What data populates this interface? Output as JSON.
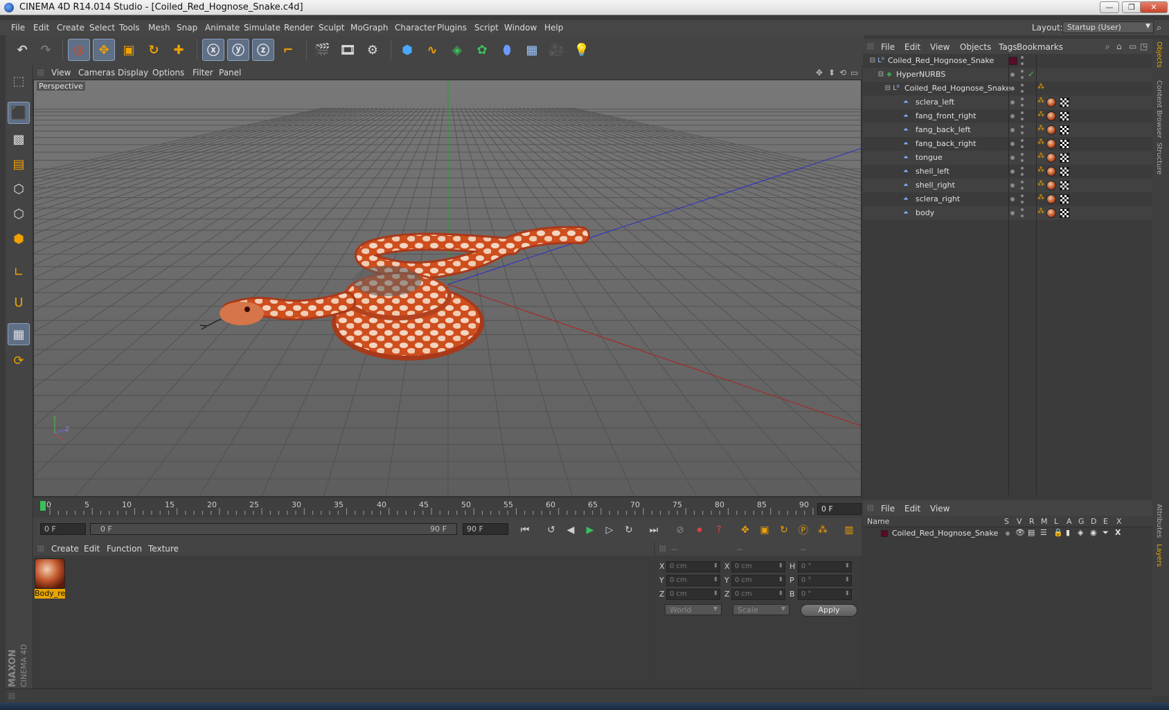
{
  "window": {
    "title": "CINEMA 4D R14.014 Studio - [Coiled_Red_Hognose_Snake.c4d]",
    "minimize": "—",
    "maximize": "❐",
    "close": "✕"
  },
  "menubar": {
    "items": [
      "File",
      "Edit",
      "Create",
      "Select",
      "Tools",
      "Mesh",
      "Snap",
      "Animate",
      "Simulate",
      "Render",
      "Sculpt",
      "MoGraph",
      "Character",
      "Plugins",
      "Script",
      "Window",
      "Help"
    ],
    "layout_label": "Layout:",
    "layout_value": "Startup (User)"
  },
  "viewport": {
    "menu": [
      "View",
      "Cameras",
      "Display",
      "Options",
      "Filter",
      "Panel"
    ],
    "label": "Perspective",
    "axis_y": "Y",
    "axis_z": "Z"
  },
  "timeline": {
    "ticks": [
      "0",
      "5",
      "10",
      "15",
      "20",
      "25",
      "30",
      "35",
      "40",
      "45",
      "50",
      "55",
      "60",
      "65",
      "70",
      "75",
      "80",
      "85",
      "90"
    ],
    "current_frame": "0 F"
  },
  "transport": {
    "start": "0 F",
    "range_start": "0 F",
    "range_end": "90 F",
    "end": "90 F"
  },
  "material_manager": {
    "menu": [
      "Create",
      "Edit",
      "Function",
      "Texture"
    ],
    "materials": [
      {
        "label": "Body_re"
      }
    ]
  },
  "coordinates": {
    "headers": [
      "--",
      "--",
      "--"
    ],
    "rows": [
      {
        "p_label": "X",
        "p_value": "0 cm",
        "s_label": "X",
        "s_value": "0 cm",
        "r_label": "H",
        "r_value": "0 °"
      },
      {
        "p_label": "Y",
        "p_value": "0 cm",
        "s_label": "Y",
        "s_value": "0 cm",
        "r_label": "P",
        "r_value": "0 °"
      },
      {
        "p_label": "Z",
        "p_value": "0 cm",
        "s_label": "Z",
        "s_value": "0 cm",
        "r_label": "B",
        "r_value": "0 °"
      }
    ],
    "space_select": "World",
    "mode_select": "Scale",
    "apply_label": "Apply"
  },
  "object_manager": {
    "menu": [
      "File",
      "Edit",
      "View",
      "Objects",
      "Tags",
      "Bookmarks"
    ],
    "objects": [
      {
        "name": "Coiled_Red_Hognose_Snake",
        "type": "null"
      },
      {
        "name": "HyperNURBS",
        "type": "hypernurbs"
      },
      {
        "name": "Coiled_Red_Hognose_Snake",
        "type": "null"
      },
      {
        "name": "sclera_left",
        "type": "mesh"
      },
      {
        "name": "fang_front_right",
        "type": "mesh"
      },
      {
        "name": "fang_back_left",
        "type": "mesh"
      },
      {
        "name": "fang_back_right",
        "type": "mesh"
      },
      {
        "name": "tongue",
        "type": "mesh"
      },
      {
        "name": "shell_left",
        "type": "mesh"
      },
      {
        "name": "shell_right",
        "type": "mesh"
      },
      {
        "name": "sclera_right",
        "type": "mesh"
      },
      {
        "name": "body",
        "type": "mesh"
      }
    ]
  },
  "layer_manager": {
    "menu": [
      "File",
      "Edit",
      "View"
    ],
    "columns": [
      "Name",
      "S",
      "V",
      "R",
      "M",
      "L",
      "A",
      "G",
      "D",
      "E",
      "X"
    ],
    "layers": [
      {
        "name": "Coiled_Red_Hognose_Snake",
        "color": "#5a0a2a"
      }
    ]
  },
  "side_tabs": [
    "Objects",
    "Content Browser",
    "Structure",
    "Attributes",
    "Layers"
  ],
  "colors": {
    "accent_orange": "#e8a400",
    "active_blue": "#5e6f86",
    "snake_red": "#c84a1e"
  }
}
